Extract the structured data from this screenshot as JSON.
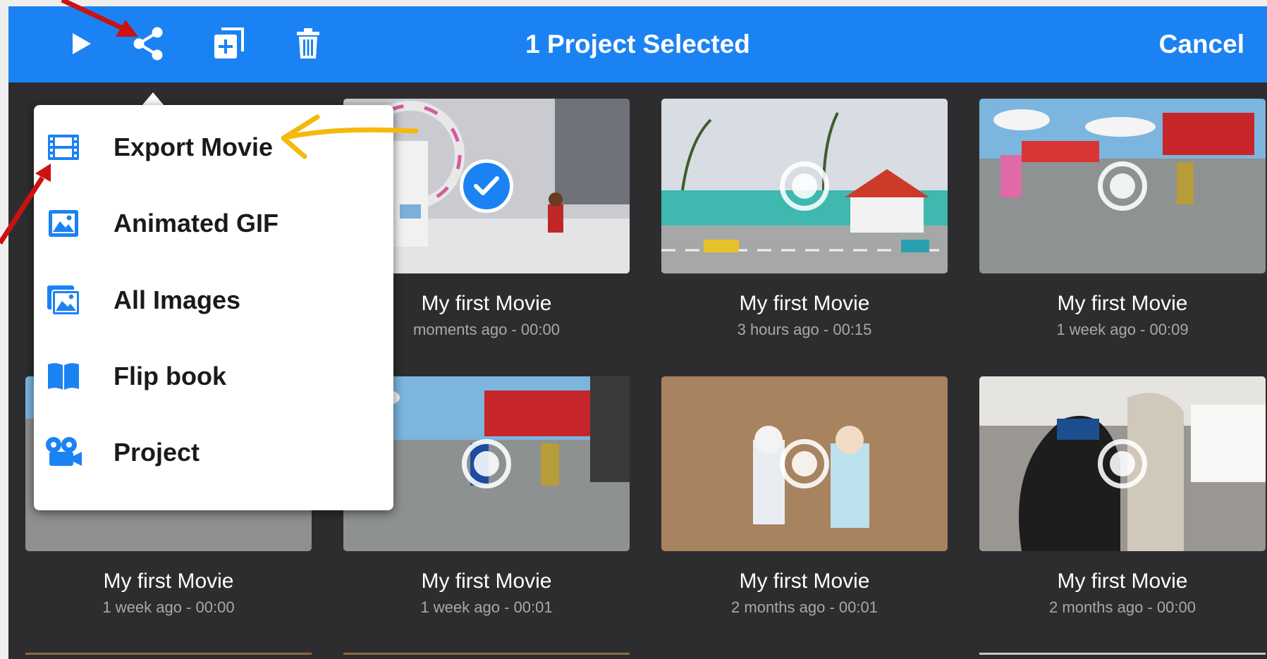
{
  "toolbar": {
    "title": "1 Project Selected",
    "cancel_label": "Cancel",
    "icons": [
      "play-icon",
      "share-icon",
      "duplicate-icon",
      "trash-icon"
    ],
    "background_color": "#1b82f3"
  },
  "share_menu": {
    "items": [
      {
        "label": "Export Movie",
        "icon": "film-icon"
      },
      {
        "label": "Animated GIF",
        "icon": "image-icon"
      },
      {
        "label": "All Images",
        "icon": "images-icon"
      },
      {
        "label": "Flip book",
        "icon": "book-icon"
      },
      {
        "label": "Project",
        "icon": "movie-camera-icon"
      }
    ],
    "icon_color": "#1b82f3"
  },
  "projects": [
    {
      "title": "My first Movie",
      "subtitle": "moments ago - 00:00",
      "selected": true
    },
    {
      "title": "My first Movie",
      "subtitle": "3 hours ago - 00:15",
      "selected": false
    },
    {
      "title": "My first Movie",
      "subtitle": "1 week ago - 00:09",
      "selected": false
    },
    {
      "title": "My first Movie",
      "subtitle": "1 week ago - 00:00",
      "selected": false
    },
    {
      "title": "My first Movie",
      "subtitle": "1 week ago - 00:01",
      "selected": false
    },
    {
      "title": "My first Movie",
      "subtitle": "2 months ago - 00:01",
      "selected": false
    },
    {
      "title": "My first Movie",
      "subtitle": "2 months ago - 00:00",
      "selected": false
    }
  ],
  "annotations": {
    "red_arrow_color": "#cc1111",
    "yellow_arrow_color": "#f5b90c"
  }
}
